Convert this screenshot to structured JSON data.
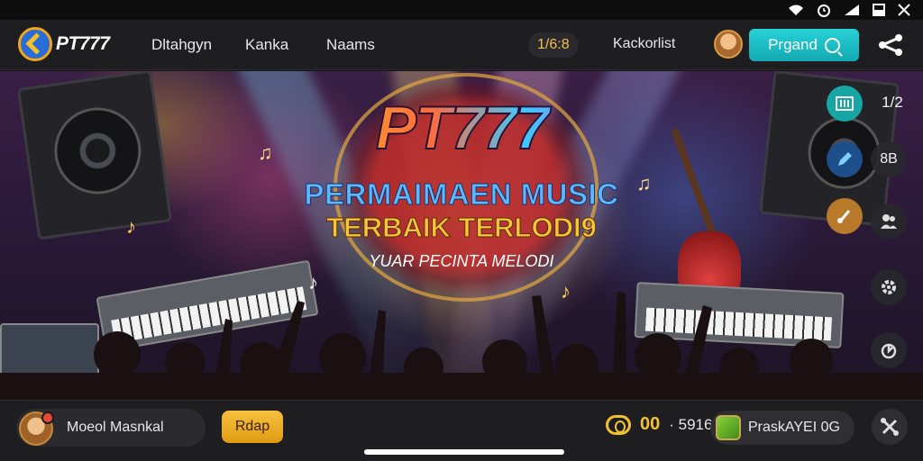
{
  "status_bar": {
    "icons": [
      "wifi-icon",
      "alarm-icon",
      "signal-icon",
      "battery-icon",
      "close-icon"
    ]
  },
  "nav": {
    "logo_text": "PT777",
    "links": [
      "Dltahgyn",
      "Kanka",
      "Naams"
    ],
    "timer": "1/6:8",
    "username": "Kackorlist",
    "cta_label": "Prgand",
    "share_icon": "share-icon"
  },
  "hero": {
    "title": "PT777",
    "subtitle_line1": "PERMAIMAEN MUSIC",
    "subtitle_line2": "TERBAIK TERLODI9",
    "tagline": "YUAR PECINTA MELODI"
  },
  "right_rail": {
    "label_top": "1/2",
    "label_second": "8B",
    "buttons": [
      "equalizer-icon",
      "edit-icon",
      "music-note-icon",
      "users-icon",
      "settings-icon",
      "refresh-icon"
    ]
  },
  "bottom_bar": {
    "track_name": "Moeol Masnkal",
    "play_label": "Rdap",
    "coin_value": "00",
    "coin_count": "· 5916",
    "reward_label": "PraskAYEI 0G",
    "tools_icon": "tools-icon"
  },
  "colors": {
    "accent_cyan": "#1fbfc8",
    "accent_gold": "#f2c12e",
    "bar_background": "#1e1e21"
  }
}
